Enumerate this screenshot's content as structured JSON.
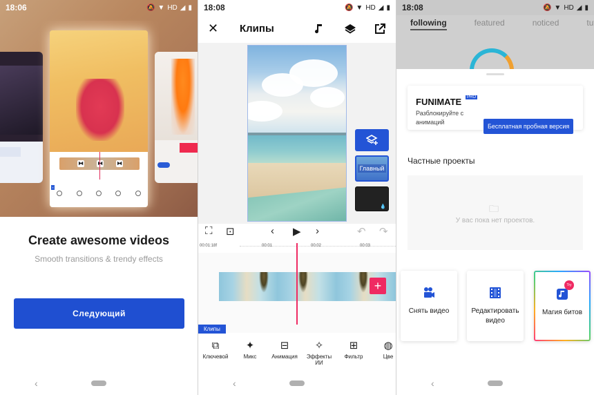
{
  "status": {
    "screen1_time": "18:06",
    "screen2_time": "18:08",
    "screen3_time": "18:08",
    "network": "HD"
  },
  "onboarding": {
    "title": "Create awesome videos",
    "subtitle": "Smooth transitions & trendy effects",
    "next_label": "Следующий"
  },
  "editor": {
    "title": "Клипы",
    "main_label": "Главный",
    "clips_tag": "Клипы",
    "time_total": "00:01:18f",
    "ruler": [
      "00:01",
      "00:02",
      "00:03"
    ],
    "tools": [
      {
        "label": "Ключевой",
        "icon": "keyframe-icon"
      },
      {
        "label": "Микс",
        "icon": "magic-wand-icon"
      },
      {
        "label": "Анимация",
        "icon": "animation-icon"
      },
      {
        "label": "Эффекты ИИ",
        "icon": "ai-effects-icon"
      },
      {
        "label": "Фильтр",
        "icon": "filter-icon"
      },
      {
        "label": "Цве",
        "icon": "palette-icon"
      }
    ]
  },
  "home": {
    "tabs": [
      "following",
      "featured",
      "noticed",
      "tuto"
    ],
    "brand": "FUNIMATE",
    "pro_badge": "PRO",
    "promo_text": "Разблокируйте с анимаций",
    "trial_label": "Бесплатная пробная версия",
    "section_title": "Частные проекты",
    "empty_message": "У вас пока нет проектов.",
    "actions": [
      {
        "label": "Снять видео",
        "icon": "camera-icon"
      },
      {
        "label": "Редактировать видео",
        "icon": "film-icon"
      },
      {
        "label": "Магия битов",
        "icon": "music-note-icon",
        "badge": "Try"
      }
    ]
  },
  "colors": {
    "primary": "#1f4fd1",
    "accent_pink": "#ef2a62"
  }
}
